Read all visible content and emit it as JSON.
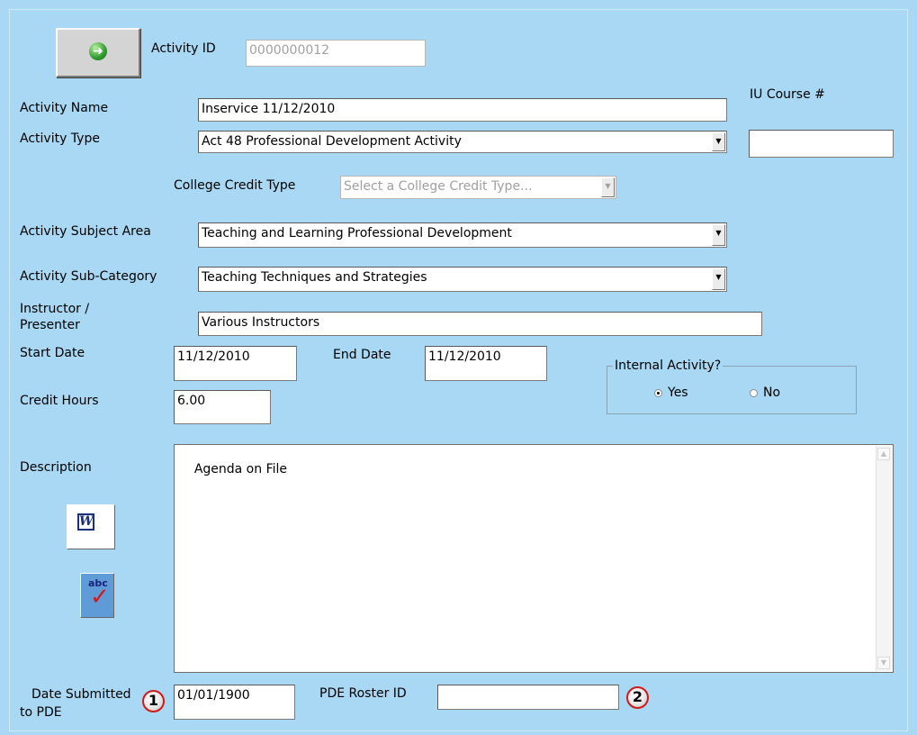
{
  "form": {
    "activity_id_label": "Activity ID",
    "activity_id_value": "0000000012",
    "iu_course_label": "IU Course #",
    "iu_course_value": "",
    "activity_name_label": "Activity Name",
    "activity_name_value": "Inservice 11/12/2010",
    "activity_type_label": "Activity Type",
    "activity_type_value": "Act 48 Professional Development Activity",
    "college_credit_label": "College Credit Type",
    "college_credit_value": "Select a College Credit Type...",
    "subject_area_label": "Activity Subject Area",
    "subject_area_value": "Teaching and Learning Professional Development",
    "sub_category_label": "Activity Sub-Category",
    "sub_category_value": "Teaching Techniques and Strategies",
    "instructor_label_line1": "Instructor /",
    "instructor_label_line2": "Presenter",
    "instructor_value": "Various Instructors",
    "start_date_label": "Start Date",
    "start_date_value": "11/12/2010",
    "end_date_label": "End Date",
    "end_date_value": "11/12/2010",
    "internal_label": "Internal Activity?",
    "internal_yes": "Yes",
    "internal_no": "No",
    "internal_selected": "Yes",
    "credit_hours_label": "Credit Hours",
    "credit_hours_value": "6.00",
    "description_label": "Description",
    "description_value": "Agenda on File",
    "date_submitted_label_line1": "Date Submitted",
    "date_submitted_label_line2": "to PDE",
    "date_submitted_value": "01/01/1900",
    "pde_roster_label": "PDE Roster ID",
    "pde_roster_value": ""
  },
  "toolbar": {
    "go_icon": "green-arrow-right-icon",
    "word_icon": "word-document-icon",
    "spellcheck_icon": "spellcheck-icon",
    "spellcheck_text": "abc"
  },
  "callouts": {
    "badge1": "1",
    "badge2": "2"
  },
  "colors": {
    "background": "#a8d8f3",
    "callout_border": "#d41818"
  }
}
